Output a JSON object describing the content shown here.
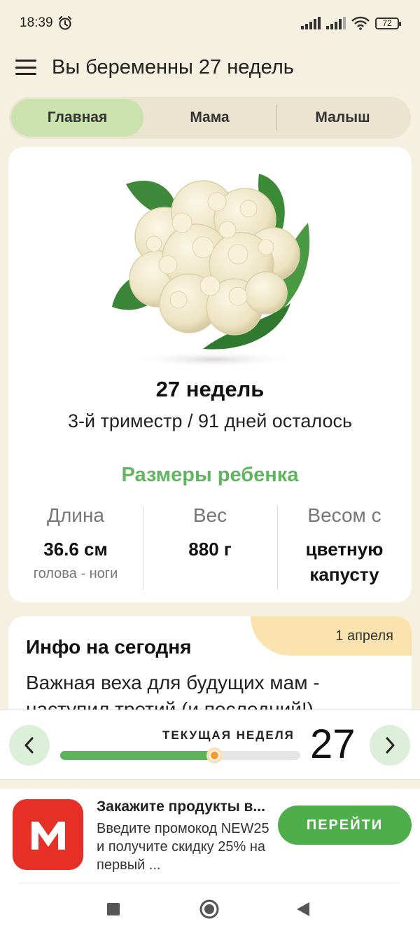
{
  "status_bar": {
    "time": "18:39",
    "battery": "72",
    "icons": [
      "alarm-icon",
      "signal-icon",
      "signal-icon",
      "wifi-icon",
      "battery-icon"
    ]
  },
  "header": {
    "title": "Вы беременны 27 недель",
    "menu_icon": "menu-icon"
  },
  "tabs": [
    {
      "label": "Главная",
      "active": true
    },
    {
      "label": "Мама",
      "active": false
    },
    {
      "label": "Малыш",
      "active": false
    }
  ],
  "week_card": {
    "image": "cauliflower-illustration",
    "week_title": "27 недель",
    "subtitle": "3-й триместр / 91 дней осталось",
    "sizes_title": "Размеры ребенка",
    "stats": [
      {
        "label": "Длина",
        "value": "36.6 см",
        "note": "голова - ноги"
      },
      {
        "label": "Вес",
        "value": "880 г",
        "note": ""
      },
      {
        "label": "Весом с",
        "value": "цветную капусту",
        "note": ""
      }
    ]
  },
  "info_card": {
    "title": "Инфо на сегодня",
    "date": "1 апреля",
    "text": "Важная веха для будущих мам - наступил третий (и последний!)"
  },
  "week_bar": {
    "label": "ТЕКУЩАЯ НЕДЕЛЯ",
    "week": "27",
    "progress": 0.64
  },
  "ad": {
    "icon_letter": "M",
    "title": "Закажите продукты в...",
    "description": "Введите промокод NEW25 и получите скидку 25% на первый ...",
    "button": "ПЕРЕЙТИ"
  },
  "colors": {
    "accent_green": "#5fb65e",
    "tab_active": "#c9e2ae",
    "thumb_orange": "#f59a2e",
    "ad_red": "#e63027"
  }
}
